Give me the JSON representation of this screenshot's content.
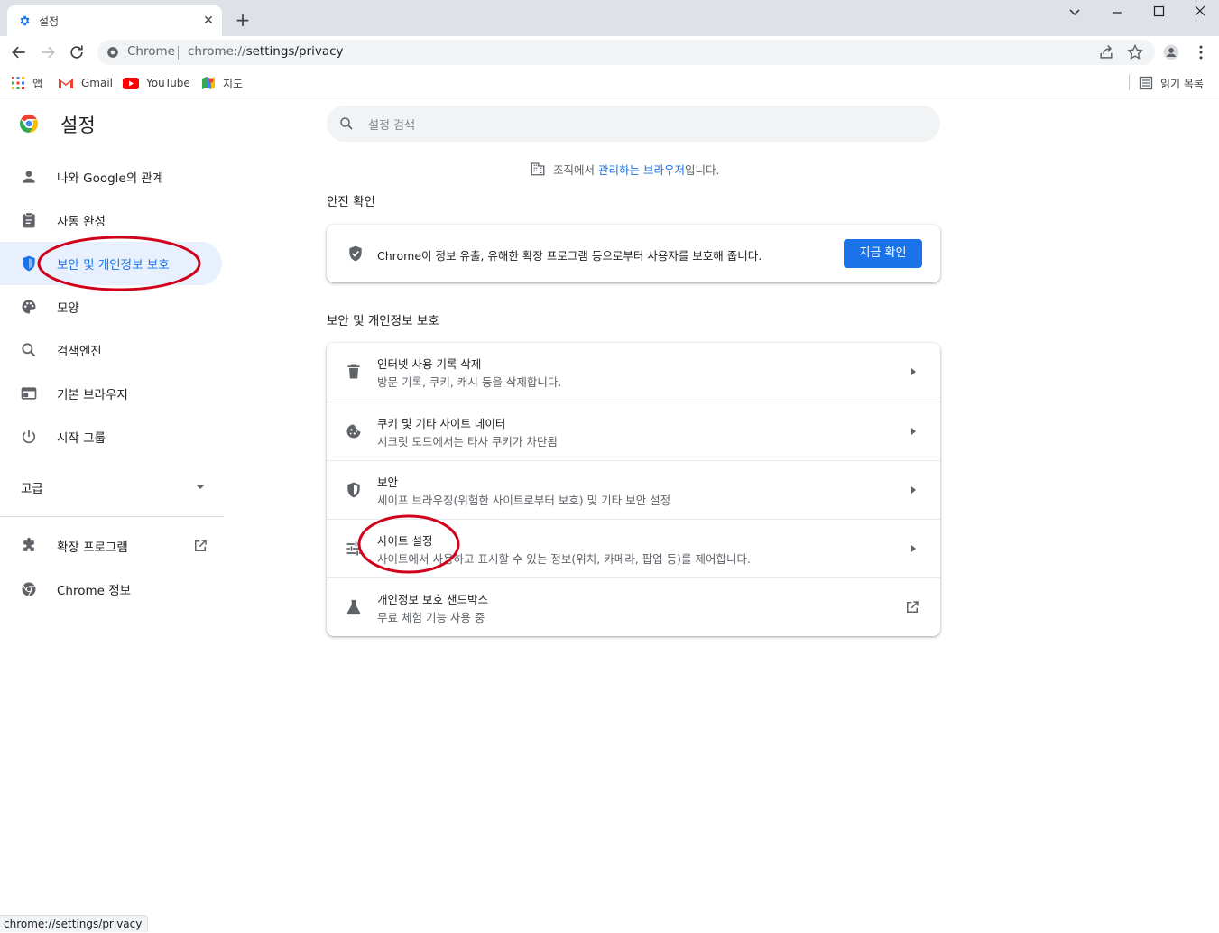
{
  "tab": {
    "title": "설정",
    "close": "✕"
  },
  "window": {
    "new_tab": "+"
  },
  "omnibox": {
    "chip": "Chrome",
    "url_host": "chrome://",
    "url_path": "settings/privacy"
  },
  "bookmarks": [
    {
      "label": "앱",
      "icon": "apps-grid-icon"
    },
    {
      "label": "Gmail",
      "icon": "gmail-icon"
    },
    {
      "label": "YouTube",
      "icon": "youtube-icon"
    },
    {
      "label": "지도",
      "icon": "maps-icon"
    }
  ],
  "reading_list": "읽기 목록",
  "sidebar": {
    "title": "설정",
    "items": [
      {
        "label": "나와 Google의 관계",
        "icon": "person-icon"
      },
      {
        "label": "자동 완성",
        "icon": "clipboard-icon"
      },
      {
        "label": "보안 및 개인정보 보호",
        "icon": "shield-icon"
      },
      {
        "label": "모양",
        "icon": "palette-icon"
      },
      {
        "label": "검색엔진",
        "icon": "search-icon"
      },
      {
        "label": "기본 브라우저",
        "icon": "browser-icon"
      },
      {
        "label": "시작 그룹",
        "icon": "power-icon"
      }
    ],
    "advanced": "고급",
    "extensions": "확장 프로그램",
    "about": "Chrome 정보"
  },
  "search": {
    "placeholder": "설정 검색"
  },
  "managed": {
    "prefix": "조직에서 ",
    "link": "관리하는 브라우저",
    "suffix": "입니다."
  },
  "safety": {
    "heading": "안전 확인",
    "text": "Chrome이 정보 유출, 유해한 확장 프로그램 등으로부터 사용자를 보호해 줍니다.",
    "button": "지금 확인"
  },
  "privacy": {
    "heading": "보안 및 개인정보 보호",
    "rows": [
      {
        "title": "인터넷 사용 기록 삭제",
        "subtitle": "방문 기록, 쿠키, 캐시 등을 삭제합니다.",
        "icon": "trash-icon"
      },
      {
        "title": "쿠키 및 기타 사이트 데이터",
        "subtitle": "시크릿 모드에서는 타사 쿠키가 차단됨",
        "icon": "cookie-icon"
      },
      {
        "title": "보안",
        "subtitle": "세이프 브라우징(위험한 사이트로부터 보호) 및 기타 보안 설정",
        "icon": "security-shield-icon"
      },
      {
        "title": "사이트 설정",
        "subtitle": "사이트에서 사용하고 표시할 수 있는 정보(위치, 카메라, 팝업 등)를 제어합니다.",
        "icon": "tune-icon"
      },
      {
        "title": "개인정보 보호 샌드박스",
        "subtitle": "무료 체험 기능 사용 중",
        "icon": "flask-icon"
      }
    ]
  },
  "status_bar": "chrome://settings/privacy",
  "colors": {
    "accent": "#1a73e8",
    "active_bg": "#e8f0fe",
    "annotation": "#d0021b"
  }
}
